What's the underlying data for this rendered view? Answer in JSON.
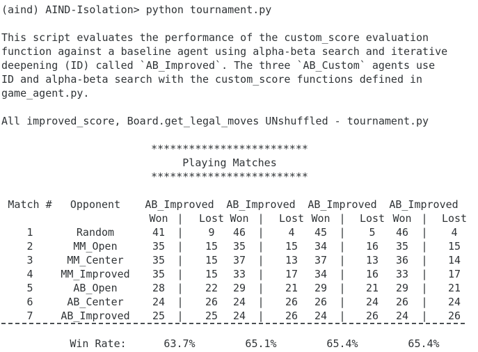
{
  "prompt": "(aind) AIND-Isolation> python tournament.py",
  "intro": [
    "This script evaluates the performance of the custom_score evaluation",
    "function against a baseline agent using alpha-beta search and iterative",
    "deepening (ID) called `AB_Improved`. The three `AB_Custom` agents use",
    "ID and alpha-beta search with the custom_score functions defined in",
    "game_agent.py."
  ],
  "note": "All improved_score, Board.get_legal_moves UNshuffled - tournament.py",
  "banner": {
    "stars": "*************************",
    "title": "Playing Matches"
  },
  "table": {
    "match_header": "Match #",
    "opponent_header": "Opponent",
    "agents": [
      "AB_Improved",
      "AB_Improved",
      "AB_Improved",
      "AB_Improved"
    ],
    "won_label": "Won",
    "lost_label": "Lost",
    "separator": "|",
    "rows": [
      {
        "match": "1",
        "opponent": "Random",
        "results": [
          [
            "41",
            "9"
          ],
          [
            "46",
            "4"
          ],
          [
            "45",
            "5"
          ],
          [
            "46",
            "4"
          ]
        ]
      },
      {
        "match": "2",
        "opponent": "MM_Open",
        "results": [
          [
            "35",
            "15"
          ],
          [
            "35",
            "15"
          ],
          [
            "34",
            "16"
          ],
          [
            "35",
            "15"
          ]
        ]
      },
      {
        "match": "3",
        "opponent": "MM_Center",
        "results": [
          [
            "35",
            "15"
          ],
          [
            "37",
            "13"
          ],
          [
            "37",
            "13"
          ],
          [
            "36",
            "14"
          ]
        ]
      },
      {
        "match": "4",
        "opponent": "MM_Improved",
        "results": [
          [
            "35",
            "15"
          ],
          [
            "33",
            "17"
          ],
          [
            "34",
            "16"
          ],
          [
            "33",
            "17"
          ]
        ]
      },
      {
        "match": "5",
        "opponent": "AB_Open",
        "results": [
          [
            "28",
            "22"
          ],
          [
            "29",
            "21"
          ],
          [
            "29",
            "21"
          ],
          [
            "29",
            "21"
          ]
        ]
      },
      {
        "match": "6",
        "opponent": "AB_Center",
        "results": [
          [
            "24",
            "26"
          ],
          [
            "24",
            "26"
          ],
          [
            "26",
            "24"
          ],
          [
            "26",
            "24"
          ]
        ]
      },
      {
        "match": "7",
        "opponent": "AB_Improved",
        "results": [
          [
            "25",
            "25"
          ],
          [
            "24",
            "26"
          ],
          [
            "24",
            "26"
          ],
          [
            "24",
            "26"
          ]
        ]
      }
    ],
    "win_rate_label": "Win Rate:",
    "win_rates": [
      "63.7%",
      "65.1%",
      "65.4%",
      "65.4%"
    ]
  }
}
